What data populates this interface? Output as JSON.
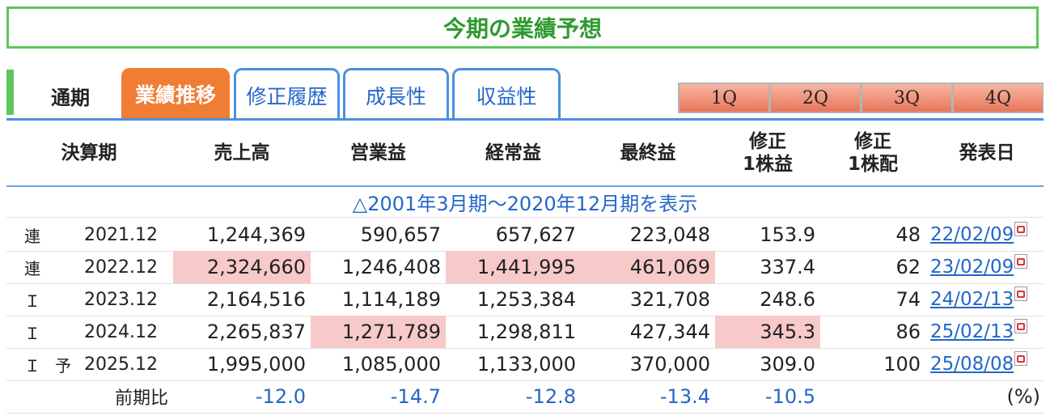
{
  "title": "今期の業績予想",
  "tabs": {
    "static": "通期",
    "items": [
      {
        "label": "業績推移",
        "active": true
      },
      {
        "label": "修正履歴",
        "active": false
      },
      {
        "label": "成長性",
        "active": false
      },
      {
        "label": "収益性",
        "active": false
      }
    ]
  },
  "quarters": [
    "1Q",
    "2Q",
    "3Q",
    "4Q"
  ],
  "table": {
    "headers": {
      "period": "決算期",
      "sales": "売上高",
      "operating": "営業益",
      "ordinary": "経常益",
      "net": "最終益",
      "eps_line1": "修正",
      "eps_line2": "1株益",
      "div_line1": "修正",
      "div_line2": "1株配",
      "date": "発表日"
    },
    "expand_link": "△2001年3月期〜2020年12月期を表示",
    "rows": [
      {
        "type": "連",
        "forecast": "",
        "period": "2021.12",
        "sales": "1,244,369",
        "operating": "590,657",
        "ordinary": "657,627",
        "net": "223,048",
        "eps": "153.9",
        "div": "48",
        "date": "22/02/09"
      },
      {
        "type": "連",
        "forecast": "",
        "period": "2022.12",
        "sales": "2,324,660",
        "operating": "1,246,408",
        "ordinary": "1,441,995",
        "net": "461,069",
        "eps": "337.4",
        "div": "62",
        "date": "23/02/09"
      },
      {
        "type": "Ｉ",
        "forecast": "",
        "period": "2023.12",
        "sales": "2,164,516",
        "operating": "1,114,189",
        "ordinary": "1,253,384",
        "net": "321,708",
        "eps": "248.6",
        "div": "74",
        "date": "24/02/13"
      },
      {
        "type": "Ｉ",
        "forecast": "",
        "period": "2024.12",
        "sales": "2,265,837",
        "operating": "1,271,789",
        "ordinary": "1,298,811",
        "net": "427,344",
        "eps": "345.3",
        "div": "86",
        "date": "25/02/13"
      },
      {
        "type": "Ｉ",
        "forecast": "予",
        "period": "2025.12",
        "sales": "1,995,000",
        "operating": "1,085,000",
        "ordinary": "1,133,000",
        "net": "370,000",
        "eps": "309.0",
        "div": "100",
        "date": "25/08/08"
      }
    ],
    "comparison": {
      "label": "前期比",
      "sales": "-12.0",
      "operating": "-14.7",
      "ordinary": "-12.8",
      "net": "-13.4",
      "eps": "-10.5",
      "unit": "(%)"
    }
  },
  "colors": {
    "accent_green": "#5cc65c",
    "active_tab": "#ef7d34",
    "tab_blue": "#4a90e2",
    "highlight": "#f7c9c9",
    "link_blue": "#2466c8"
  },
  "icons": {
    "date_link": "pdf-icon"
  }
}
